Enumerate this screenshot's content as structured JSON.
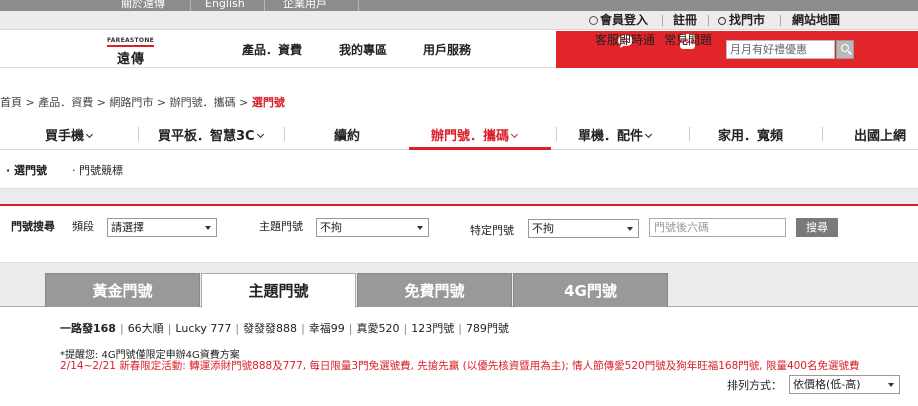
{
  "topbar": {
    "about": "關於遠傳",
    "english": "English",
    "enterprise": "企業用戶"
  },
  "secbar": {
    "login": "會員登入",
    "register": "註冊",
    "store": "找門市",
    "sitemap": "網站地圖"
  },
  "header": {
    "logo_en": "FAREASTONE",
    "logo_zh": "遠傳",
    "nav": [
      "產品．資費",
      "我的專區",
      "用戶服務"
    ],
    "chat_label": "客服即時通",
    "faq_label": "常見問題",
    "faq_icon_text": "Q&A",
    "search_placeholder": "月月有好禮優惠",
    "accent": "#e1252b"
  },
  "breadcrumb": {
    "path": "首頁 > 產品．資費 > 網路門市 > 辦門號．攜碼 > ",
    "current": "選門號"
  },
  "catnav": [
    "買手機",
    "買平板．智慧3C",
    "續約",
    "辦門號．攜碼",
    "單機．配件",
    "家用．寬頻",
    "出國上網"
  ],
  "subnav": {
    "item1": "選門號",
    "item2": "門號競標"
  },
  "filter": {
    "title": "門號搜尋",
    "band_label": "頻段",
    "band_value": "請選擇",
    "theme_label": "主題門號",
    "theme_value": "不拘",
    "special_label": "特定門號",
    "special_value": "不拘",
    "tail_placeholder": "門號後六碼",
    "search_button": "搜尋"
  },
  "tabs": [
    "黃金門號",
    "主題門號",
    "免費門號",
    "4G門號"
  ],
  "number_links": [
    "一路發168",
    "66大順",
    "Lucky 777",
    "發發發888",
    "幸福99",
    "真愛520",
    "123門號",
    "789門號"
  ],
  "notice": "*提醒您: 4G門號僅限定申辦4G資費方案",
  "promo": "2/14~2/21 新春限定活動: 轉運添財門號888及777, 每日限量3門免選號費, 先搶先贏 (以優先核資暨用為主); 情人節傳愛520門號及狗年旺福168門號, 限量400名免選號費",
  "sort": {
    "label": "排列方式：",
    "value": "依價格(低-高)"
  }
}
